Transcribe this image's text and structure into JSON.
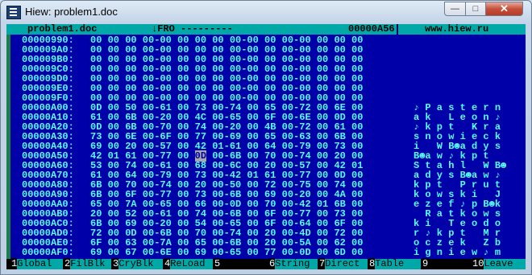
{
  "window": {
    "title": "Hiew: problem1.doc",
    "minimize": "—",
    "maximize": "□",
    "close": "✕"
  },
  "status": {
    "filename": "problem1.doc",
    "mode": "↓FRO ---------",
    "offset": "00000A56",
    "url": "www.hiew.ru"
  },
  "rows": [
    {
      "off": "00000990:",
      "hex": "00 00 00 00-00 00 00 00 00-00 00 00-00 00 00 00",
      "txt": ""
    },
    {
      "off": "000009A0:",
      "hex": "00 00 00 00-00 00 00 00 00-00 00 00-00 00 00 00",
      "txt": ""
    },
    {
      "off": "000009B0:",
      "hex": "00 00 00 00-00 00 00 00 00-00 00 00-00 00 00 00",
      "txt": ""
    },
    {
      "off": "000009C0:",
      "hex": "00 00 00 00-00 00 00 00 00-00 00 00-00 00 00 00",
      "txt": ""
    },
    {
      "off": "000009D0:",
      "hex": "00 00 00 00-00 00 00 00 00-00 00 00-00 00 00 00",
      "txt": ""
    },
    {
      "off": "000009E0:",
      "hex": "00 00 00 00-00 00 00 00 00-00 00 00-00 00 00 00",
      "txt": ""
    },
    {
      "off": "000009F0:",
      "hex": "00 00 00 00-00 00 00 00 00-00 00 00-00 00 00 00",
      "txt": ""
    },
    {
      "off": "00000A00:",
      "hex": "0D 00 50 00-61 00 73 00-74 00 65 00-72 00 6E 00",
      "txt": "♪ P a s t e r n"
    },
    {
      "off": "00000A10:",
      "hex": "61 00 6B 00-20 00 4C 00-65 00 6F 00-6E 00 0D 00",
      "txt": "a k   L e o n ♪"
    },
    {
      "off": "00000A20:",
      "hex": "0D 00 6B 00-70 00 74 00-20 00 4B 00-72 00 61 00",
      "txt": "♪ k p t   K r a"
    },
    {
      "off": "00000A30:",
      "hex": "73 00 6E 00-6F 00 77 00-69 00 65 00-63 00 6B 00",
      "txt": "s n o w i e c k"
    },
    {
      "off": "00000A40:",
      "hex": "69 00 20 00-57 00 42 01-61 00 64 00-79 00 73 00",
      "txt": "i   W B☻a d y s"
    },
    {
      "off": "00000A50:",
      "hex": "42 01 61 00-77 00 0D 00-6B 00 70 00-74 00 20 00",
      "txt": "B☻a w ♪ k p t"
    },
    {
      "off": "00000A60:",
      "hex": "53 00 74 00-61 00 68 00-6C 00 20 00-57 00 42 01",
      "txt": "S t a h l   W B☻"
    },
    {
      "off": "00000A70:",
      "hex": "61 00 64 00-79 00 73 00-42 01 61 00-77 00 0D 00",
      "txt": "a d y s B☻a w ♪"
    },
    {
      "off": "00000A80:",
      "hex": "6B 00 70 00-74 00 20 00-50 00 72 00-75 00 74 00",
      "txt": "k p t   P r u t"
    },
    {
      "off": "00000A90:",
      "hex": "6B 00 6F 00-77 00 73 00-6B 00 69 00-20 00 4A 00",
      "txt": "k o w s k i   J"
    },
    {
      "off": "00000AA0:",
      "hex": "65 00 7A 00-65 00 66 00-0D 00 70 00-42 01 6B 00",
      "txt": "e z e f ♪ p B☻k"
    },
    {
      "off": "00000AB0:",
      "hex": "20 00 52 00-61 00 74 00-6B 00 6F 00-77 00 73 00",
      "txt": "  R a t k o w s"
    },
    {
      "off": "00000AC0:",
      "hex": "6B 00 69 00-20 00 54 00-65 00 6F 00-64 00 6F 00",
      "txt": "k i   T e o d o"
    },
    {
      "off": "00000AD0:",
      "hex": "72 00 0D 00-6B 00 70 00-74 00 20 00-4D 00 72 00",
      "txt": "r ♪ k p t   M r"
    },
    {
      "off": "00000AE0:",
      "hex": "6F 00 63 00-7A 00 65 00-6B 00 20 00-5A 00 62 00",
      "txt": "o c z e k   Z b"
    },
    {
      "off": "00000AF0:",
      "hex": "69 00 67 00-6E 00 69 00-65 00 77 00-0D 00 6D 00",
      "txt": "i g n i e w ♪ m"
    }
  ],
  "fkeys": [
    {
      "n": "1",
      "l": "Global"
    },
    {
      "n": "2",
      "l": "FilBlk"
    },
    {
      "n": "3",
      "l": "CryBlk"
    },
    {
      "n": "4",
      "l": "ReLoad"
    },
    {
      "n": "5",
      "l": ""
    },
    {
      "n": "6",
      "l": "String"
    },
    {
      "n": "7",
      "l": "Direct"
    },
    {
      "n": "8",
      "l": "Table"
    },
    {
      "n": "9",
      "l": ""
    },
    {
      "n": "10",
      "l": "Leave"
    }
  ]
}
